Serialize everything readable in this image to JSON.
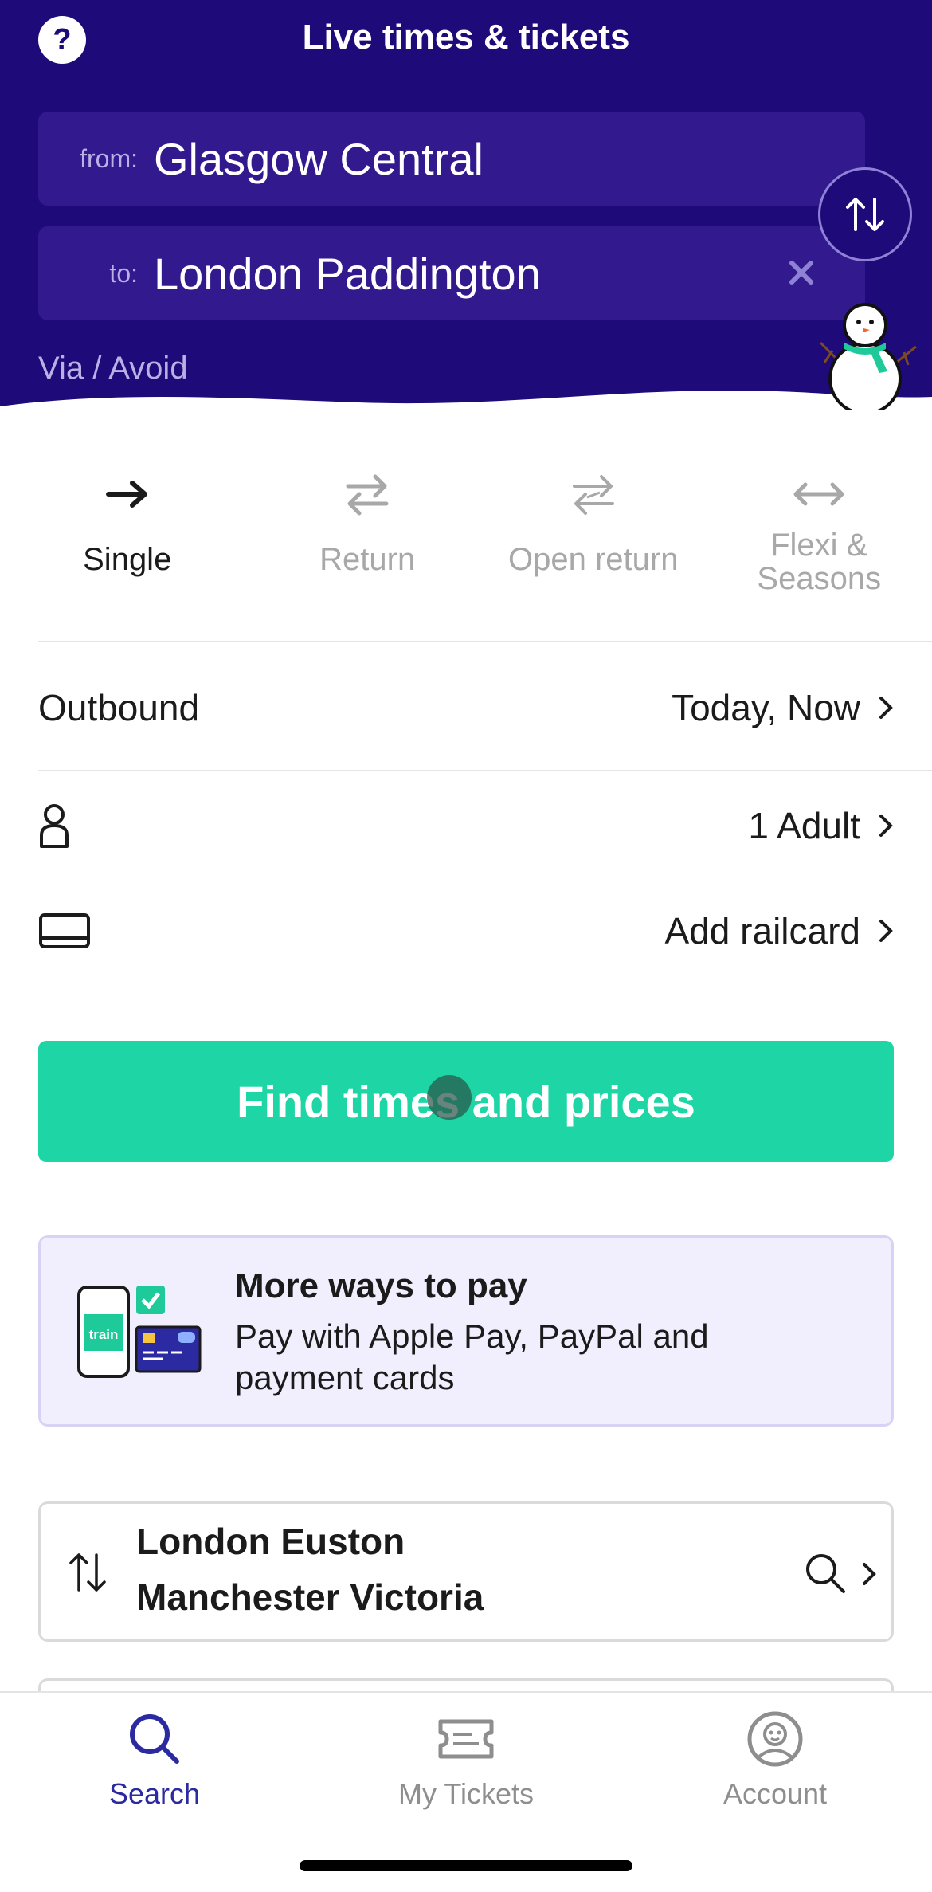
{
  "header": {
    "help_icon": "question-icon",
    "title": "Live times & tickets",
    "from_label": "from:",
    "from_value": "Glasgow Central",
    "to_label": "to:",
    "to_value": "London Paddington",
    "clear_icon": "close-icon",
    "swap_icon": "swap-vertical-icon",
    "via_label": "Via / Avoid",
    "brand_color": "#1e0a78"
  },
  "ticket_types": [
    {
      "label": "Single",
      "icon": "arrow-right-icon",
      "selected": true
    },
    {
      "label": "Return",
      "icon": "return-arrows-icon",
      "selected": false
    },
    {
      "label": "Open return",
      "icon": "open-return-icon",
      "selected": false
    },
    {
      "label": "Flexi & Seasons",
      "line1": "Flexi &",
      "line2": "Seasons",
      "icon": "double-arrow-icon",
      "selected": false
    }
  ],
  "outbound": {
    "label": "Outbound",
    "value": "Today, Now"
  },
  "passengers": {
    "icon": "person-icon",
    "value": "1 Adult"
  },
  "railcard": {
    "icon": "railcard-icon",
    "value": "Add railcard"
  },
  "find_button": {
    "label": "Find times and prices",
    "color": "#1ed6a5"
  },
  "promo": {
    "art_label": "train",
    "title": "More ways to pay",
    "body": "Pay with Apple Pay, PayPal and payment cards"
  },
  "recent_search": {
    "from": "London Euston",
    "to": "Manchester Victoria"
  },
  "tabbar": {
    "tabs": [
      {
        "label": "Search",
        "icon": "search-icon",
        "active": true
      },
      {
        "label": "My Tickets",
        "icon": "ticket-icon",
        "active": false
      },
      {
        "label": "Account",
        "icon": "account-icon",
        "active": false
      }
    ],
    "active_color": "#2b2aa0"
  }
}
